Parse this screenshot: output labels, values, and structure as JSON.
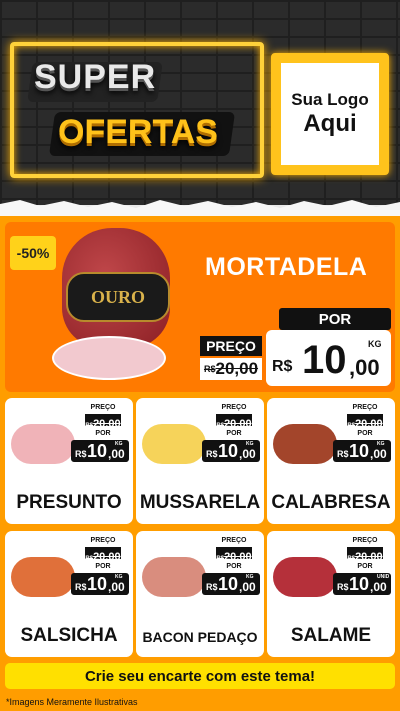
{
  "header": {
    "title_line1": "SUPER",
    "title_line2": "OFERTAS",
    "logo_line1": "Sua Logo",
    "logo_line2": "Aqui"
  },
  "featured": {
    "badge": "-50%",
    "name": "MORTADELA",
    "brand_label": "OURO",
    "preco_label": "PREÇO",
    "old_currency": "R$",
    "old_price": "20,00",
    "por_label": "POR",
    "currency": "R$",
    "price_int": "10",
    "price_dec": ",00",
    "unit": "KG"
  },
  "products": [
    {
      "name": "PRESUNTO",
      "preco_label": "PREÇO",
      "old_currency": "R$",
      "old_price": "20,00",
      "por_label": "POR",
      "currency": "R$",
      "price_int": "10",
      "price_dec": ",00",
      "unit": "KG",
      "image_color": "#f0b3b8"
    },
    {
      "name": "MUSSARELA",
      "preco_label": "PREÇO",
      "old_currency": "R$",
      "old_price": "20,00",
      "por_label": "POR",
      "currency": "R$",
      "price_int": "10",
      "price_dec": ",00",
      "unit": "KG",
      "image_color": "#f6d35a"
    },
    {
      "name": "CALABRESA",
      "preco_label": "PREÇO",
      "old_currency": "R$",
      "old_price": "20,00",
      "por_label": "POR",
      "currency": "R$",
      "price_int": "10",
      "price_dec": ",00",
      "unit": "KG",
      "image_color": "#a3452b"
    },
    {
      "name": "SALSICHA",
      "preco_label": "PREÇO",
      "old_currency": "R$",
      "old_price": "20,00",
      "por_label": "POR",
      "currency": "R$",
      "price_int": "10",
      "price_dec": ",00",
      "unit": "KG",
      "image_color": "#e0703a"
    },
    {
      "name": "BACON PEDAÇO",
      "preco_label": "PREÇO",
      "old_currency": "R$",
      "old_price": "20,00",
      "por_label": "POR",
      "currency": "R$",
      "price_int": "10",
      "price_dec": ",00",
      "unit": "KG",
      "image_color": "#d98d7e"
    },
    {
      "name": "SALAME",
      "preco_label": "PREÇO",
      "old_currency": "R$",
      "old_price": "20,00",
      "por_label": "POR",
      "currency": "R$",
      "price_int": "10",
      "price_dec": ",00",
      "unit": "UNID",
      "image_color": "#b5303a"
    }
  ],
  "cta": "Crie seu encarte com este tema!",
  "footnote": "*Imagens Meramente Ilustrativas",
  "colors": {
    "accent": "#ff9d00",
    "feature": "#ff7a00",
    "cta": "#ffe000",
    "neon": "#ffd23a"
  }
}
